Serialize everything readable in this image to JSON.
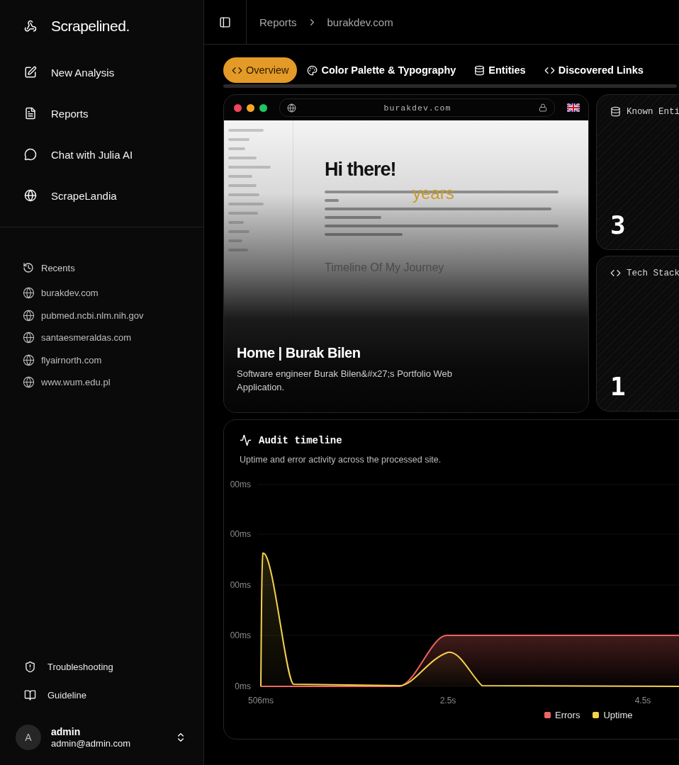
{
  "sidebar": {
    "brand": "Scrapelined.",
    "nav": [
      {
        "label": "New Analysis"
      },
      {
        "label": "Reports"
      },
      {
        "label": "Chat with Julia AI"
      },
      {
        "label": "ScrapeLandia"
      }
    ],
    "recents_title": "Recents",
    "recents": [
      "burakdev.com",
      "pubmed.ncbi.nlm.nih.gov",
      "santaesmeraldas.com",
      "flyairnorth.com",
      "www.wum.edu.pl"
    ],
    "footer_links": [
      {
        "label": "Troubleshooting"
      },
      {
        "label": "Guideline"
      }
    ],
    "user": {
      "initial": "A",
      "name": "admin",
      "email": "admin@admin.com"
    }
  },
  "header": {
    "breadcrumb": [
      "Reports",
      "burakdev.com"
    ]
  },
  "tabs": [
    {
      "label": "Overview",
      "selected": true
    },
    {
      "label": "Color Palette & Typography",
      "selected": false
    },
    {
      "label": "Entities",
      "selected": false
    },
    {
      "label": "Discovered Links",
      "selected": false
    }
  ],
  "preview": {
    "url": "burakdev.com",
    "site": {
      "heading": "Hi there!",
      "highlight": "years",
      "section": "Timeline Of My Journey"
    },
    "title": "Home | Burak Bilen",
    "description": "Software engineer Burak Bilen&#x27;s Portfolio Web Application."
  },
  "stats": [
    {
      "label": "Known Enti",
      "value": "3"
    },
    {
      "label": "Tech Stack",
      "value": "1"
    }
  ],
  "timeline": {
    "title": "Audit timeline",
    "subtitle": "Uptime and error activity across the processed site.",
    "y_tick_labels": [
      "00ms",
      "00ms",
      "00ms",
      "00ms",
      "0ms"
    ],
    "x_tick_labels": [
      "506ms",
      "2.5s",
      "4.5s"
    ],
    "legend": [
      {
        "label": "Errors",
        "color": "#ef6461"
      },
      {
        "label": "Uptime",
        "color": "#f5d04c"
      }
    ]
  }
}
